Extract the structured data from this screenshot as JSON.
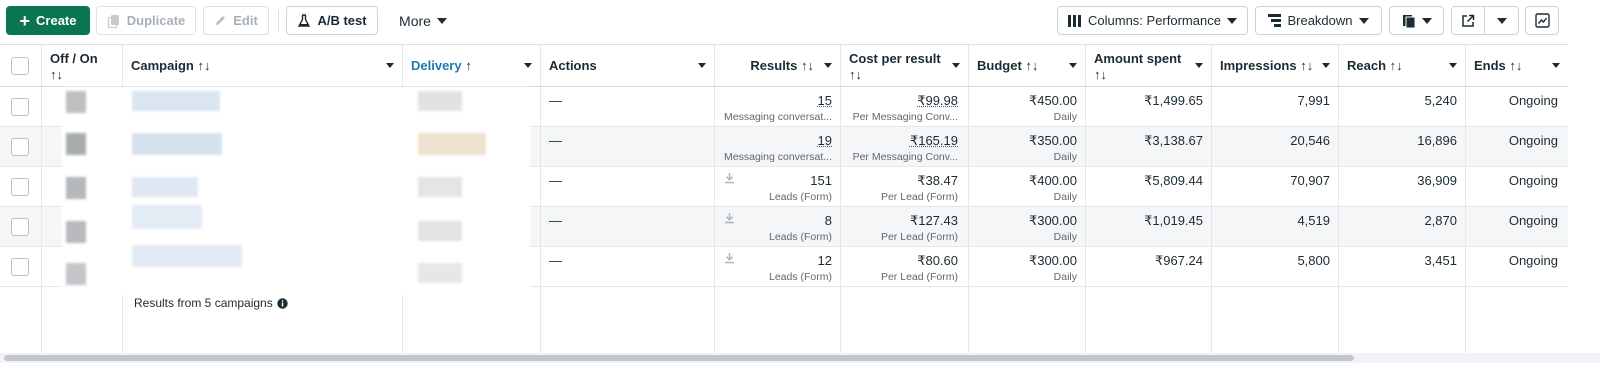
{
  "toolbar": {
    "create_label": "Create",
    "duplicate_label": "Duplicate",
    "edit_label": "Edit",
    "ab_test_label": "A/B test",
    "more_label": "More",
    "columns_label": "Columns: Performance",
    "breakdown_label": "Breakdown"
  },
  "table": {
    "headers": {
      "offon": "Off / On",
      "campaign": "Campaign",
      "delivery": "Delivery",
      "actions": "Actions",
      "results": "Results",
      "cost_per_result": "Cost per result",
      "budget": "Budget",
      "amount_spent": "Amount spent",
      "impressions": "Impressions",
      "reach": "Reach",
      "ends": "Ends"
    },
    "sort_both": "↑↓",
    "sort_up": "↑",
    "rows": [
      {
        "actions": "—",
        "results": "15",
        "results_sub": "Messaging conversat...",
        "cost": "₹99.98",
        "cost_sub": "Per Messaging Conv...",
        "budget": "₹450.00",
        "budget_sub": "Daily",
        "spent": "₹1,499.65",
        "impressions": "7,991",
        "reach": "5,240",
        "ends": "Ongoing"
      },
      {
        "actions": "—",
        "results": "19",
        "results_sub": "Messaging conversat...",
        "cost": "₹165.19",
        "cost_sub": "Per Messaging Conv...",
        "budget": "₹350.00",
        "budget_sub": "Daily",
        "spent": "₹3,138.67",
        "impressions": "20,546",
        "reach": "16,896",
        "ends": "Ongoing"
      },
      {
        "actions": "—",
        "results": "151",
        "results_sub": "Leads (Form)",
        "cost": "₹38.47",
        "cost_sub": "Per Lead (Form)",
        "budget": "₹400.00",
        "budget_sub": "Daily",
        "spent": "₹5,809.44",
        "impressions": "70,907",
        "reach": "36,909",
        "ends": "Ongoing"
      },
      {
        "actions": "—",
        "results": "8",
        "results_sub": "Leads (Form)",
        "cost": "₹127.43",
        "cost_sub": "Per Lead (Form)",
        "budget": "₹300.00",
        "budget_sub": "Daily",
        "spent": "₹1,019.45",
        "impressions": "4,519",
        "reach": "2,870",
        "ends": "Ongoing"
      },
      {
        "actions": "—",
        "results": "12",
        "results_sub": "Leads (Form)",
        "cost": "₹80.60",
        "cost_sub": "Per Lead (Form)",
        "budget": "₹300.00",
        "budget_sub": "Daily",
        "spent": "₹967.24",
        "impressions": "5,800",
        "reach": "3,451",
        "ends": "Ongoing"
      }
    ],
    "footer": "Results from 5 campaigns"
  },
  "icons": {
    "create": "plus-icon",
    "duplicate": "duplicate-icon",
    "edit": "pencil-icon",
    "ab_test": "flask-icon",
    "columns": "columns-icon",
    "breakdown": "breakdown-icon",
    "reports": "reports-icon",
    "export": "export-icon",
    "chart": "chart-icon",
    "info": "info-icon",
    "download": "download-icon"
  },
  "colors": {
    "primary": "#0a7550",
    "delivery_header": "#1d7bb0"
  }
}
